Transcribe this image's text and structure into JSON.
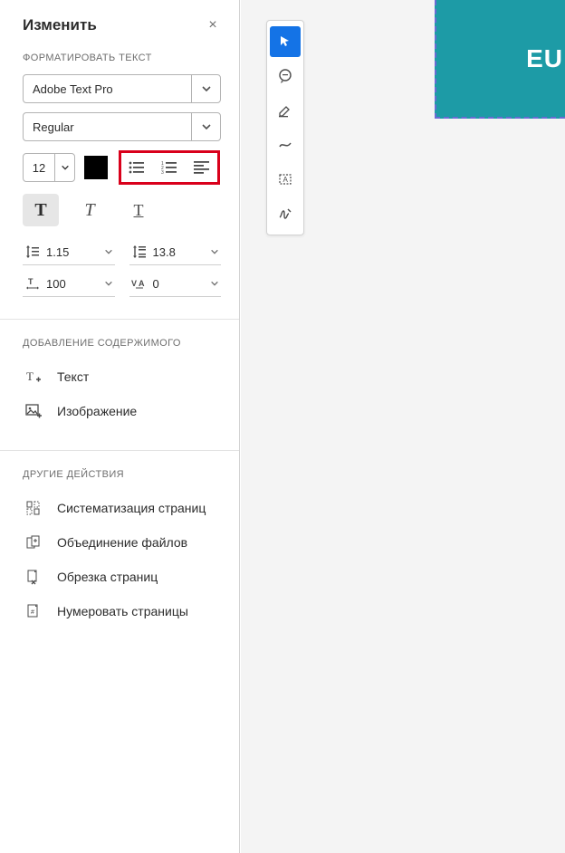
{
  "panel": {
    "title": "Изменить",
    "close_glyph": "×"
  },
  "format_text": {
    "section_label": "ФОРМАТИРОВАТЬ ТЕКСТ",
    "font_family": "Adobe Text Pro",
    "font_weight": "Regular",
    "font_size": "12",
    "color": "#000000",
    "line_height": "1.15",
    "paragraph_spacing": "13.8",
    "horizontal_scale": "100",
    "letter_spacing": "0",
    "style": {
      "bold": true,
      "italic": false,
      "underline": false
    }
  },
  "add_content": {
    "section_label": "ДОБАВЛЕНИЕ СОДЕРЖИМОГО",
    "items": [
      {
        "icon": "text-add-icon",
        "label": "Текст"
      },
      {
        "icon": "image-add-icon",
        "label": "Изображение"
      }
    ]
  },
  "other_actions": {
    "section_label": "ДРУГИЕ ДЕЙСТВИЯ",
    "items": [
      {
        "icon": "organize-pages-icon",
        "label": "Систематизация страниц"
      },
      {
        "icon": "combine-files-icon",
        "label": "Объединение файлов"
      },
      {
        "icon": "crop-pages-icon",
        "label": "Обрезка страниц"
      },
      {
        "icon": "number-pages-icon",
        "label": "Нумеровать страницы"
      }
    ]
  },
  "toolbelt": {
    "items": [
      {
        "name": "select-tool",
        "selected": true
      },
      {
        "name": "comment-tool",
        "selected": false
      },
      {
        "name": "highlight-tool",
        "selected": false
      },
      {
        "name": "draw-tool",
        "selected": false
      },
      {
        "name": "textbox-tool",
        "selected": false
      },
      {
        "name": "sign-tool",
        "selected": false
      }
    ]
  },
  "document": {
    "visible_text": "EU",
    "bg_color": "#1d9ba6"
  }
}
